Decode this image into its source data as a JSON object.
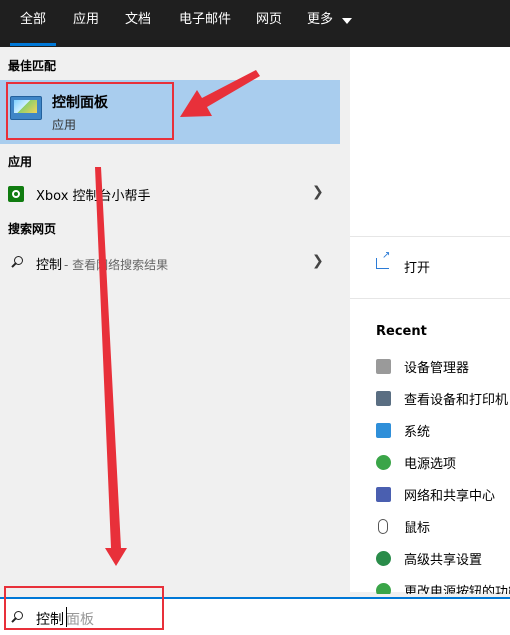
{
  "tabs": [
    {
      "label": "全部"
    },
    {
      "label": "应用"
    },
    {
      "label": "文档"
    },
    {
      "label": "电子邮件"
    },
    {
      "label": "网页"
    },
    {
      "label": "更多"
    }
  ],
  "sections": {
    "best_match": "最佳匹配",
    "apps": "应用",
    "web": "搜索网页"
  },
  "best_match": {
    "title": "控制面板",
    "subtitle": "应用"
  },
  "apps": [
    {
      "label": "Xbox 控制台小帮手",
      "icon": "xbox-icon"
    }
  ],
  "web": {
    "query": "控制",
    "suffix": " - 查看网络搜索结果"
  },
  "detail": {
    "open_label": "打开",
    "recent_title": "Recent",
    "recent": [
      {
        "label": "设备管理器",
        "icon": "device-manager-icon"
      },
      {
        "label": "查看设备和打印机",
        "icon": "printer-icon"
      },
      {
        "label": "系统",
        "icon": "monitor-icon"
      },
      {
        "label": "电源选项",
        "icon": "power-options-icon"
      },
      {
        "label": "网络和共享中心",
        "icon": "network-icon"
      },
      {
        "label": "鼠标",
        "icon": "mouse-icon"
      },
      {
        "label": "高级共享设置",
        "icon": "sharing-icon"
      },
      {
        "label": "更改电源按钮的功能",
        "icon": "power-button-icon"
      }
    ]
  },
  "search": {
    "typed": "控制",
    "completion": "面板"
  },
  "colors": {
    "accent": "#0078d7",
    "highlight": "#a9cdee",
    "annotation": "#e8303a"
  }
}
